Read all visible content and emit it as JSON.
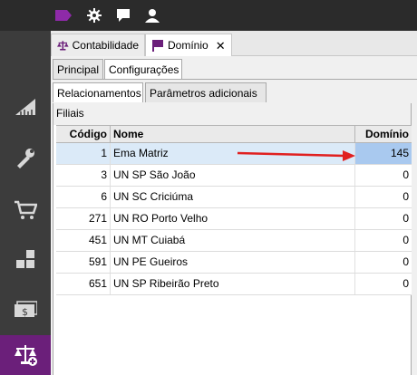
{
  "topbar": {
    "icons": [
      "tag-icon",
      "gear-icon",
      "chat-icon",
      "user-icon"
    ],
    "accent_color": "#8e2aa8"
  },
  "sidebar": {
    "items": [
      "ruler-icon",
      "tools-icon",
      "cart-icon",
      "boxes-icon",
      "money-icon",
      "scale-icon"
    ],
    "active_color": "#6b1f7a"
  },
  "doc_tabs": [
    {
      "label": "Contabilidade",
      "icon": "scale-icon"
    },
    {
      "label": "Domínio",
      "icon": "flag-icon",
      "close": "✕"
    }
  ],
  "subtabs_level1": [
    "Principal",
    "Configurações"
  ],
  "subtabs_level2": [
    "Relacionamentos",
    "Parâmetros adicionais"
  ],
  "group_title": "Filiais",
  "grid": {
    "columns": [
      "Código",
      "Nome",
      "Domínio"
    ],
    "rows": [
      {
        "code": "1",
        "name": "Ema Matriz",
        "dominio": "145"
      },
      {
        "code": "3",
        "name": "UN SP São João",
        "dominio": "0"
      },
      {
        "code": "6",
        "name": "UN SC Criciúma",
        "dominio": "0"
      },
      {
        "code": "271",
        "name": "UN RO Porto Velho",
        "dominio": "0"
      },
      {
        "code": "451",
        "name": "UN MT Cuiabá",
        "dominio": "0"
      },
      {
        "code": "591",
        "name": "UN PE Gueiros",
        "dominio": "0"
      },
      {
        "code": "651",
        "name": "UN SP Ribeirão Preto",
        "dominio": "0"
      }
    ],
    "selected_row_index": 0
  },
  "annotation": {
    "color": "#e02020"
  }
}
